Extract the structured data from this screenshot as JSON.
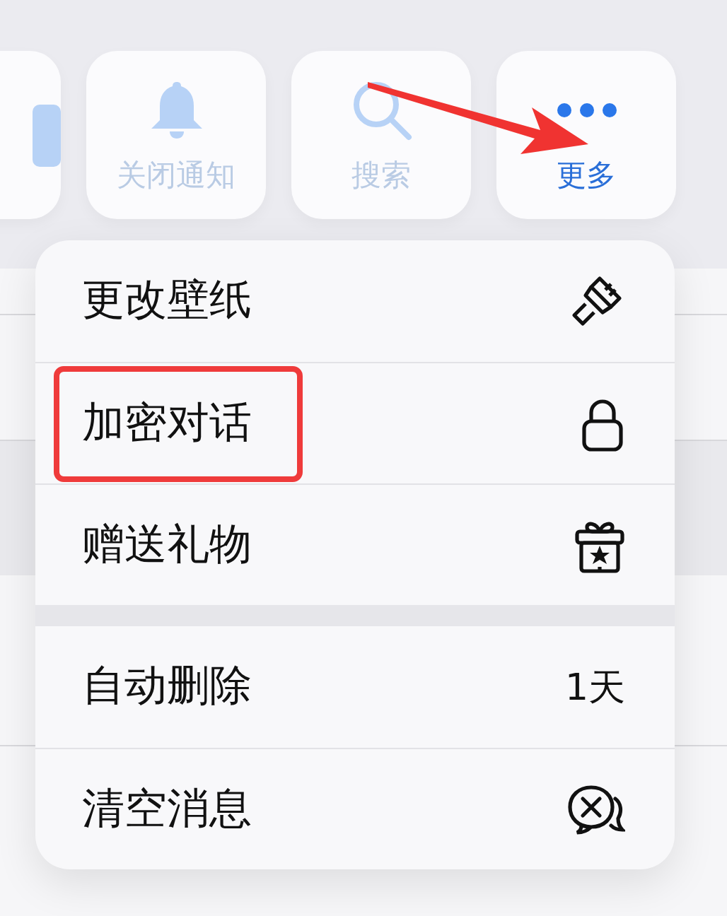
{
  "toolbar": [
    {
      "dimmed": true,
      "pointed": false
    },
    {
      "label": "关闭通知",
      "dimmed": true,
      "pointed": false
    },
    {
      "label": "搜索",
      "dimmed": true,
      "pointed": false
    },
    {
      "label": "更多",
      "dimmed": false,
      "pointed": true
    }
  ],
  "menu": {
    "groups": [
      {
        "items": [
          {
            "label": "更改壁纸",
            "kind": "icon",
            "highlighted": false
          },
          {
            "label": "加密对话",
            "kind": "icon",
            "highlighted": true
          },
          {
            "label": "赠送礼物",
            "kind": "icon",
            "highlighted": false
          }
        ]
      },
      {
        "items": [
          {
            "label": "自动删除",
            "kind": "value",
            "value": "1天",
            "highlighted": false
          },
          {
            "label": "清空消息",
            "kind": "icon",
            "highlighted": false
          }
        ]
      }
    ]
  }
}
